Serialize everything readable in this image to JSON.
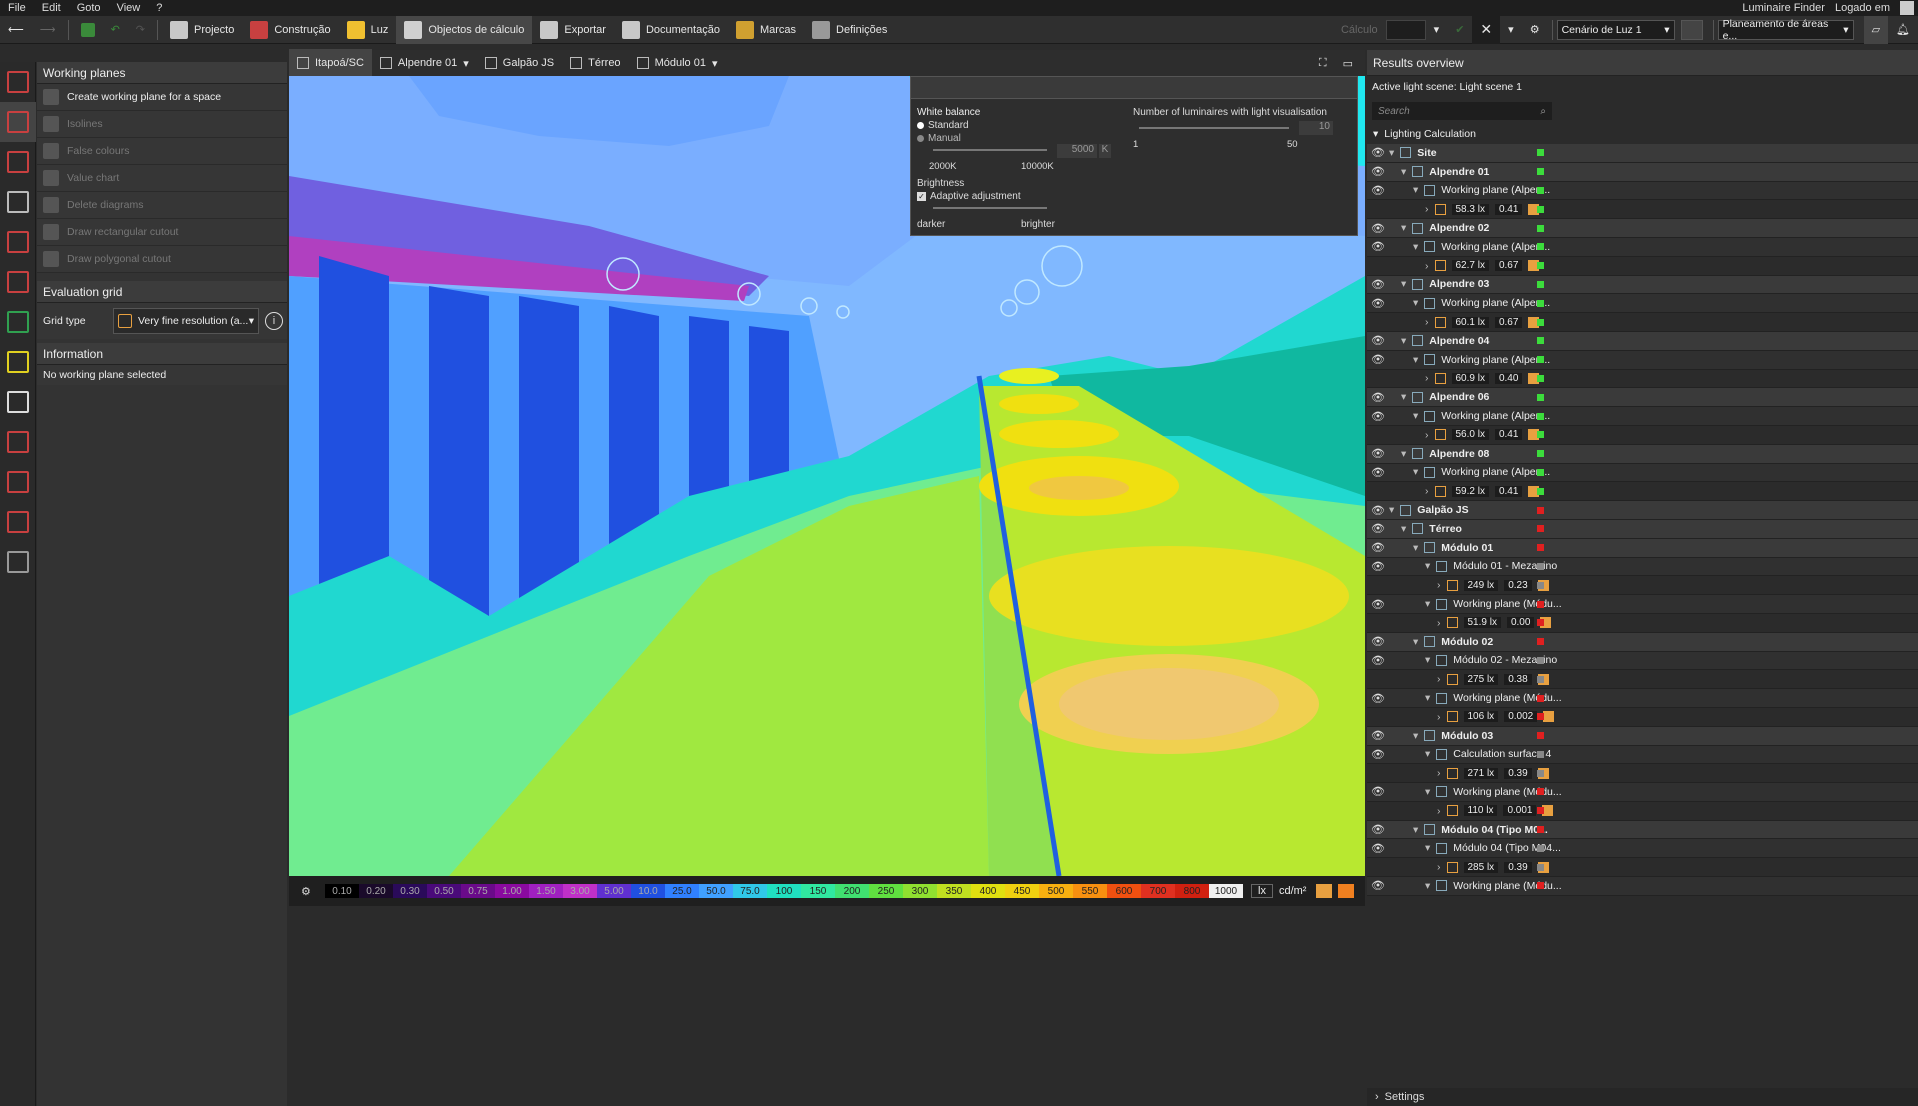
{
  "menu": [
    "File",
    "Edit",
    "Goto",
    "View",
    "?"
  ],
  "top_right": {
    "finder": "Luminaire Finder",
    "login": "Logado em"
  },
  "toolbar": {
    "tabs": [
      "Projecto",
      "Construção",
      "Luz",
      "Objectos de cálculo",
      "Exportar",
      "Documentação",
      "Marcas",
      "Definições"
    ],
    "active": "Objectos de cálculo",
    "calc_label": "Cálculo",
    "scene": "Cenário de Luz 1",
    "planning": "Planeamento de áreas e..."
  },
  "view_toolbar": {
    "crumbs": [
      "Itapoá/SC",
      "Alpendre 01",
      "Galpão JS",
      "Térreo",
      "Módulo 01"
    ]
  },
  "left": {
    "title": "Working planes",
    "items": [
      {
        "label": "Create working plane for a space",
        "enabled": true
      },
      {
        "label": "Isolines",
        "enabled": false
      },
      {
        "label": "False colours",
        "enabled": false
      },
      {
        "label": "Value chart",
        "enabled": false
      },
      {
        "label": "Delete diagrams",
        "enabled": false
      },
      {
        "label": "Draw rectangular cutout",
        "enabled": false
      },
      {
        "label": "Draw polygonal cutout",
        "enabled": false
      }
    ],
    "eval_title": "Evaluation grid",
    "grid_type_label": "Grid type",
    "grid_type_value": "Very fine resolution (a...",
    "info_title": "Information",
    "info_text": "No working plane selected"
  },
  "light_panel": {
    "wb_title": "White balance",
    "standard": "Standard",
    "manual": "Manual",
    "kelvin_value": "5000",
    "kelvin_unit": "K",
    "k_min": "2000K",
    "k_max": "10000K",
    "brightness_title": "Brightness",
    "adaptive": "Adaptive adjustment",
    "darker": "darker",
    "brighter": "brighter",
    "lum_title": "Number of luminaires with light visualisation",
    "lum_value": "10",
    "lum_min": "1",
    "lum_max": "50"
  },
  "legend": {
    "values": [
      "0.10",
      "0.20",
      "0.30",
      "0.50",
      "0.75",
      "1.00",
      "1.50",
      "3.00",
      "5.00",
      "10.0",
      "25.0",
      "50.0",
      "75.0",
      "100",
      "150",
      "200",
      "250",
      "300",
      "350",
      "400",
      "450",
      "500",
      "550",
      "600",
      "700",
      "800",
      "1000"
    ],
    "colors": [
      "#000000",
      "#1a0a2a",
      "#2a0a5a",
      "#4a0a7a",
      "#6a0a8a",
      "#8a0aa0",
      "#a020c0",
      "#c030c8",
      "#6030d0",
      "#2050e0",
      "#3080ff",
      "#40a0ff",
      "#30c8e8",
      "#20e0c0",
      "#30e8a0",
      "#40e070",
      "#60e040",
      "#90e030",
      "#c0e020",
      "#e0e010",
      "#f0d010",
      "#f8b010",
      "#f89010",
      "#f05010",
      "#e03020",
      "#d02010",
      "#f0f0f0"
    ],
    "unit1": "lx",
    "unit2": "cd/m²"
  },
  "results": {
    "title": "Results overview",
    "scene": "Active light scene: Light scene 1",
    "search_placeholder": "Search",
    "root": "Lighting Calculation",
    "rows": [
      {
        "indent": 0,
        "label": "Site",
        "bold": true,
        "status": "#3cdc3c"
      },
      {
        "indent": 1,
        "label": "Alpendre 01",
        "bold": true,
        "status": "#3cdc3c"
      },
      {
        "indent": 2,
        "label": "Working plane (Alpen...",
        "status": "#3cdc3c"
      },
      {
        "indent": 3,
        "value": "58.3 lx",
        "ratio": "0.41",
        "status": "#3cdc3c"
      },
      {
        "indent": 1,
        "label": "Alpendre 02",
        "bold": true,
        "status": "#3cdc3c"
      },
      {
        "indent": 2,
        "label": "Working plane (Alpen...",
        "status": "#3cdc3c"
      },
      {
        "indent": 3,
        "value": "62.7 lx",
        "ratio": "0.67",
        "status": "#3cdc3c"
      },
      {
        "indent": 1,
        "label": "Alpendre 03",
        "bold": true,
        "status": "#3cdc3c"
      },
      {
        "indent": 2,
        "label": "Working plane (Alpen...",
        "status": "#3cdc3c"
      },
      {
        "indent": 3,
        "value": "60.1 lx",
        "ratio": "0.67",
        "status": "#3cdc3c"
      },
      {
        "indent": 1,
        "label": "Alpendre 04",
        "bold": true,
        "status": "#3cdc3c"
      },
      {
        "indent": 2,
        "label": "Working plane (Alpen...",
        "status": "#3cdc3c"
      },
      {
        "indent": 3,
        "value": "60.9 lx",
        "ratio": "0.40",
        "status": "#3cdc3c"
      },
      {
        "indent": 1,
        "label": "Alpendre 06",
        "bold": true,
        "status": "#3cdc3c"
      },
      {
        "indent": 2,
        "label": "Working plane (Alpen...",
        "status": "#3cdc3c"
      },
      {
        "indent": 3,
        "value": "56.0 lx",
        "ratio": "0.41",
        "status": "#3cdc3c"
      },
      {
        "indent": 1,
        "label": "Alpendre 08",
        "bold": true,
        "status": "#3cdc3c"
      },
      {
        "indent": 2,
        "label": "Working plane (Alpen...",
        "status": "#3cdc3c"
      },
      {
        "indent": 3,
        "value": "59.2 lx",
        "ratio": "0.41",
        "status": "#3cdc3c"
      },
      {
        "indent": 0,
        "label": "Galpão JS",
        "bold": true,
        "status": "#e02020"
      },
      {
        "indent": 1,
        "label": "Térreo",
        "bold": true,
        "status": "#e02020"
      },
      {
        "indent": 2,
        "label": "Módulo 01",
        "bold": true,
        "status": "#e02020"
      },
      {
        "indent": 3,
        "label": "Módulo 01 - Mezanino",
        "status": "#888"
      },
      {
        "indent": 4,
        "value": "249 lx",
        "ratio": "0.23",
        "status": "#888"
      },
      {
        "indent": 3,
        "label": "Working plane (Módu...",
        "status": "#e02020"
      },
      {
        "indent": 4,
        "value": "51.9 lx",
        "ratio": "0.00",
        "status": "#e02020"
      },
      {
        "indent": 2,
        "label": "Módulo 02",
        "bold": true,
        "status": "#e02020"
      },
      {
        "indent": 3,
        "label": "Módulo 02 - Mezanino",
        "status": "#888"
      },
      {
        "indent": 4,
        "value": "275 lx",
        "ratio": "0.38",
        "status": "#888"
      },
      {
        "indent": 3,
        "label": "Working plane (Módu...",
        "status": "#e02020"
      },
      {
        "indent": 4,
        "value": "106 lx",
        "ratio": "0.002",
        "status": "#e02020"
      },
      {
        "indent": 2,
        "label": "Módulo 03",
        "bold": true,
        "status": "#e02020"
      },
      {
        "indent": 3,
        "label": "Calculation surface 4",
        "status": "#888"
      },
      {
        "indent": 4,
        "value": "271 lx",
        "ratio": "0.39",
        "status": "#888"
      },
      {
        "indent": 3,
        "label": "Working plane (Módu...",
        "status": "#e02020"
      },
      {
        "indent": 4,
        "value": "110 lx",
        "ratio": "0.001",
        "status": "#e02020"
      },
      {
        "indent": 2,
        "label": "Módulo 04 (Tipo M0...",
        "bold": true,
        "status": "#e02020"
      },
      {
        "indent": 3,
        "label": "Módulo 04 (Tipo M04...",
        "status": "#888"
      },
      {
        "indent": 4,
        "value": "285 lx",
        "ratio": "0.39",
        "status": "#888"
      },
      {
        "indent": 3,
        "label": "Working plane (Módu...",
        "status": "#e02020"
      }
    ],
    "settings": "Settings"
  }
}
